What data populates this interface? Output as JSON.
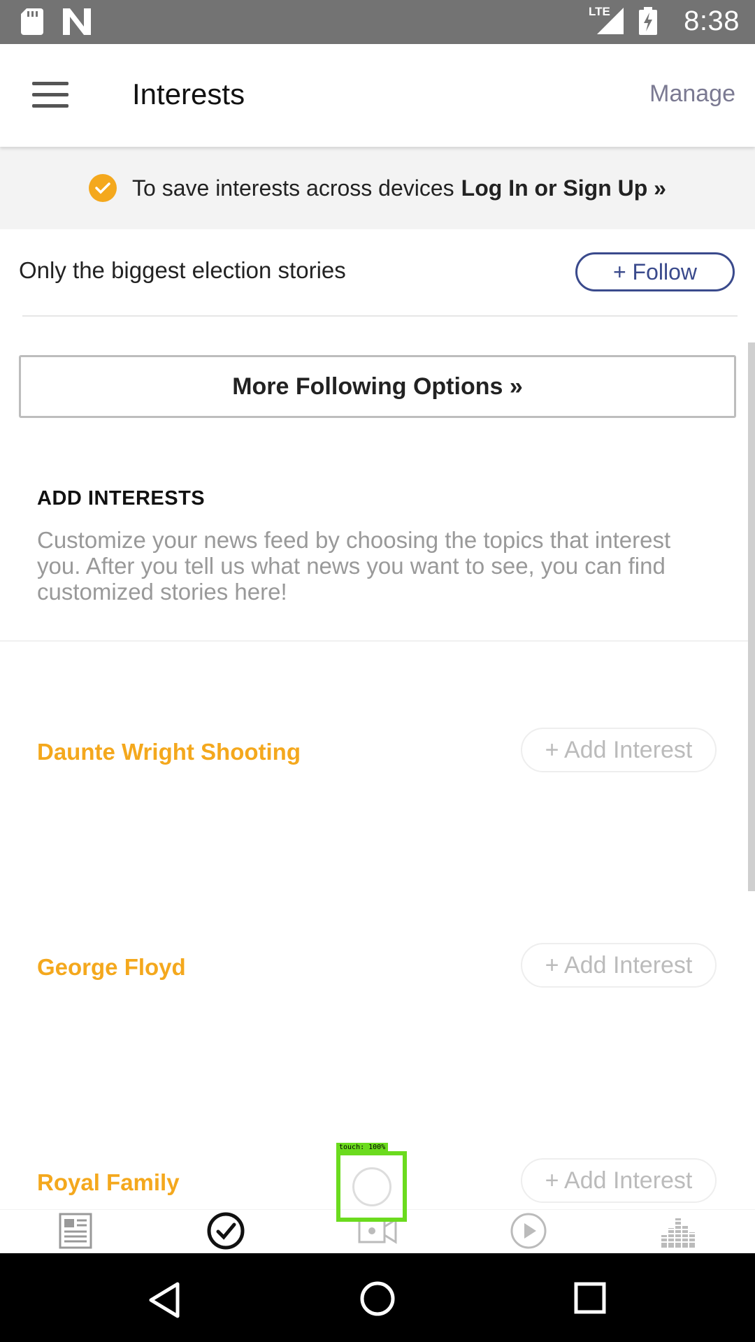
{
  "status_bar": {
    "time": "8:38",
    "network": "LTE"
  },
  "app_bar": {
    "title": "Interests",
    "manage_label": "Manage"
  },
  "banner": {
    "text": "To save interests across devices",
    "link": "Log In or Sign Up »"
  },
  "follow_row": {
    "label": "Only the biggest election stories",
    "button": "+ Follow"
  },
  "more_options_button": "More Following Options »",
  "add_interests": {
    "heading": "ADD INTERESTS",
    "description": "Customize your news feed by choosing the topics that interest you. After you tell us what news you want to see, you can find customized stories here!"
  },
  "topics": [
    {
      "name": "Daunte Wright Shooting",
      "button": "+ Add Interest"
    },
    {
      "name": "George Floyd",
      "button": "+ Add Interest"
    },
    {
      "name": "Royal Family",
      "button": "+ Add Interest"
    }
  ],
  "bottom_nav": [
    "news-icon",
    "interests-check-icon",
    "video-icon",
    "play-icon",
    "audio-icon"
  ],
  "touch_overlay": {
    "label": "touch: 100%"
  },
  "colors": {
    "accent": "#f4a81d",
    "follow_blue": "#3a4a8c",
    "status_bar": "#737373"
  }
}
